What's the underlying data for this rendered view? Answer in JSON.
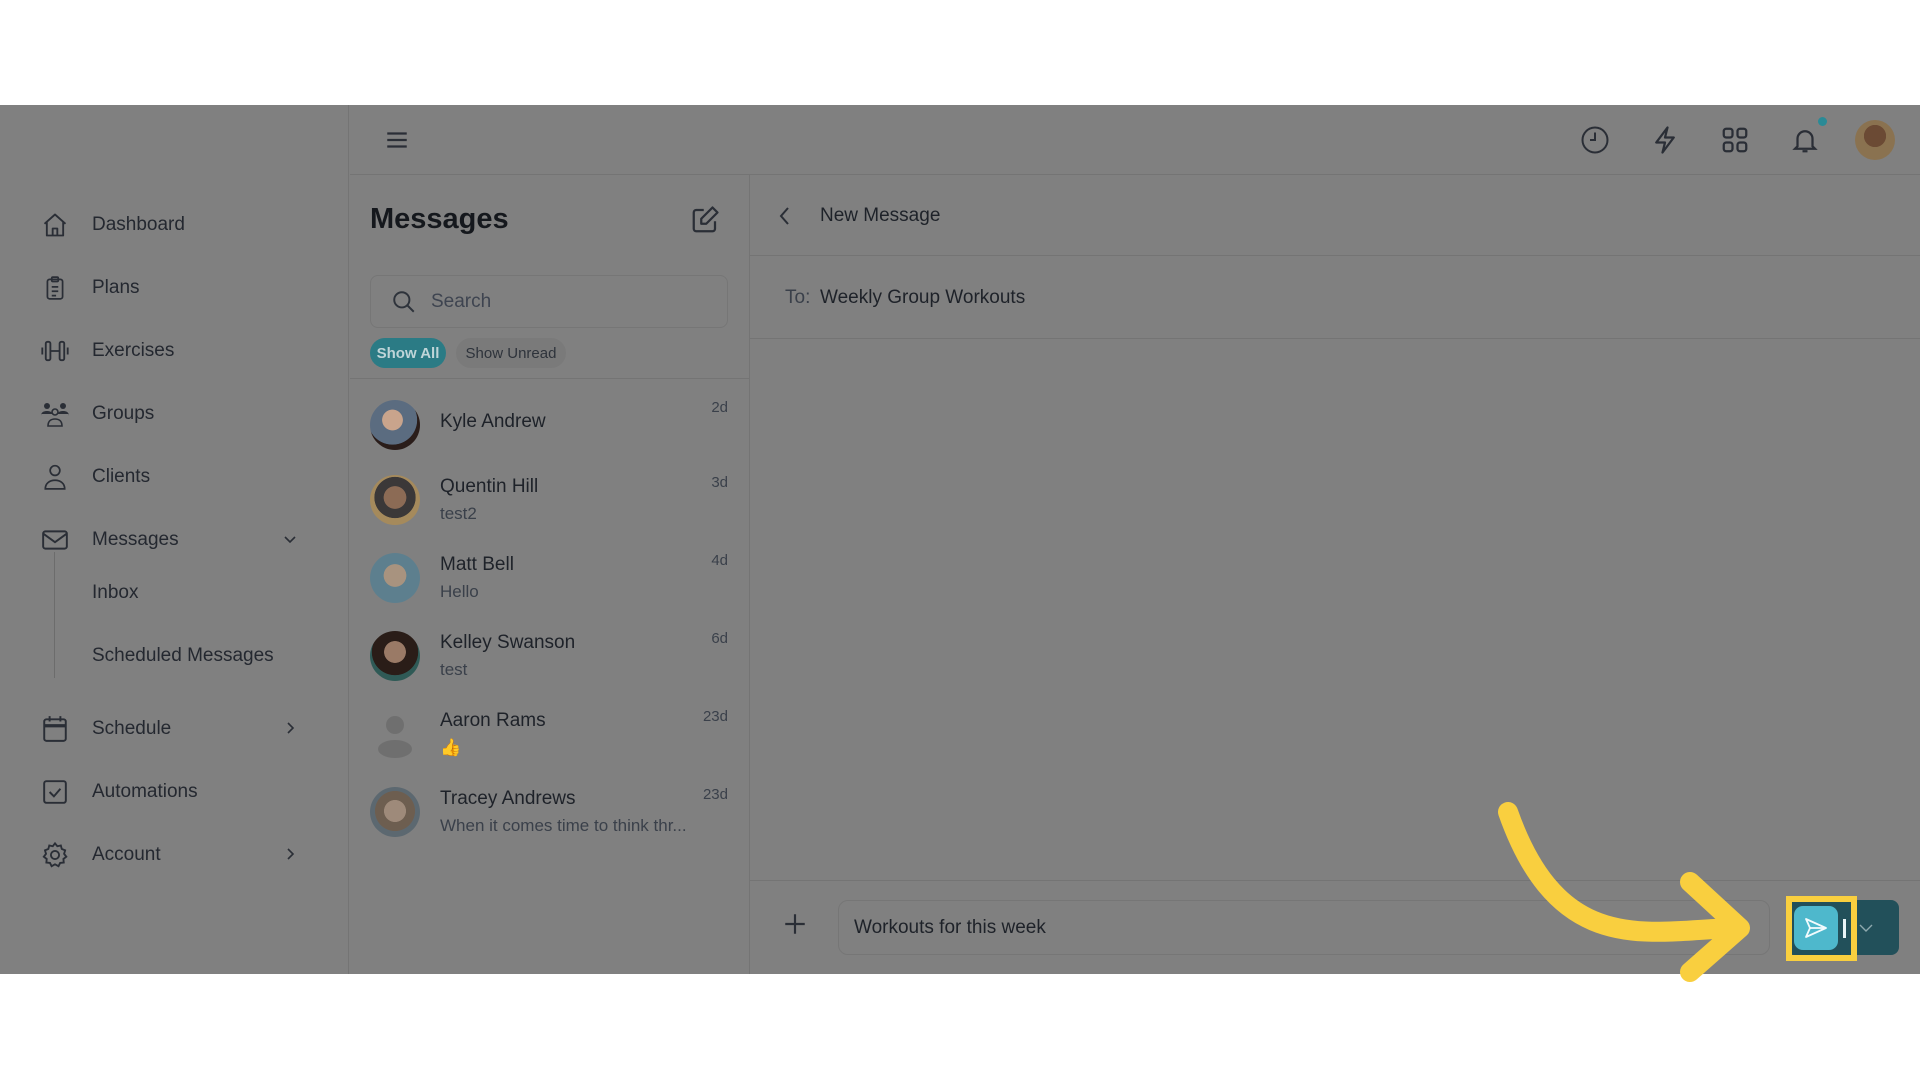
{
  "sidebar": {
    "items": [
      {
        "label": "Dashboard",
        "icon": "home-icon"
      },
      {
        "label": "Plans",
        "icon": "clipboard-icon"
      },
      {
        "label": "Exercises",
        "icon": "dumbbell-icon"
      },
      {
        "label": "Groups",
        "icon": "groups-icon"
      },
      {
        "label": "Clients",
        "icon": "user-icon"
      },
      {
        "label": "Messages",
        "icon": "mail-icon",
        "expanded": true
      },
      {
        "label": "Schedule",
        "icon": "calendar-icon"
      },
      {
        "label": "Automations",
        "icon": "checkbox-icon"
      },
      {
        "label": "Account",
        "icon": "gear-icon"
      }
    ],
    "messages_sub": [
      {
        "label": "Inbox"
      },
      {
        "label": "Scheduled Messages"
      }
    ]
  },
  "topbar": {
    "icons": [
      "menu-icon",
      "clock-icon",
      "lightning-icon",
      "grid-icon",
      "bell-icon",
      "user-avatar"
    ],
    "notification_dot_color": "#2a8a96"
  },
  "list": {
    "title": "Messages",
    "search_placeholder": "Search",
    "filters": {
      "all": "Show All",
      "unread": "Show Unread"
    },
    "conversations": [
      {
        "name": "Kyle Andrew",
        "preview": "",
        "time": "2d"
      },
      {
        "name": "Quentin Hill",
        "preview": "test2",
        "time": "3d"
      },
      {
        "name": "Matt Bell",
        "preview": "Hello",
        "time": "4d"
      },
      {
        "name": "Kelley Swanson",
        "preview": "test",
        "time": "6d"
      },
      {
        "name": "Aaron Rams",
        "preview": "👍",
        "time": "23d"
      },
      {
        "name": "Tracey Andrews",
        "preview": "When it comes time to think thr...",
        "time": "23d"
      }
    ]
  },
  "main": {
    "title": "New Message",
    "to_label": "To:",
    "to_value": "Weekly Group Workouts",
    "message_value": "Workouts for this week"
  },
  "colors": {
    "accent": "#2b7b85",
    "send_button": "#4eb8cc",
    "highlight": "#f9cf3f"
  }
}
